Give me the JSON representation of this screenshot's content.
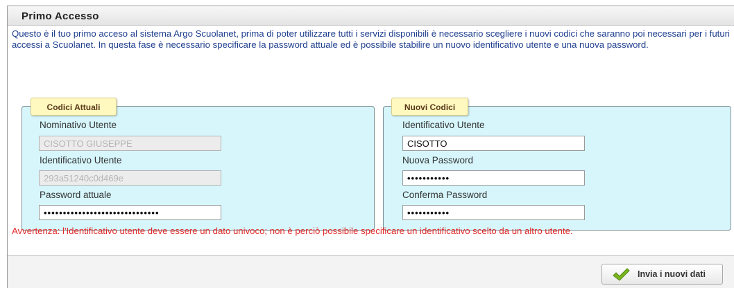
{
  "window": {
    "title": "Primo Accesso"
  },
  "intro_text": "Questo è il tuo primo acceso al sistema Argo Scuolanet, prima di poter utilizzare tutti i servizi disponibili è necessario scegliere i nuovi codici che saranno poi necessari per i futuri accessi a Scuolanet. In questa fase è necessario specificare la password attuale ed è possibile stabilire un nuovo identificativo utente e una nuova password.",
  "current_codes": {
    "legend": "Codici Attuali",
    "name_label": "Nominativo Utente",
    "name_value": "CISOTTO GIUSEPPE",
    "id_label": "Identificativo Utente",
    "id_value": "293a51240c0d469e",
    "password_label": "Password attuale",
    "password_value": "••••••••••••••••••••••••••••••"
  },
  "new_codes": {
    "legend": "Nuovi Codici",
    "id_label": "Identificativo Utente",
    "id_value": "CISOTTO",
    "new_password_label": "Nuova Password",
    "new_password_value": "•••••••••••",
    "confirm_password_label": "Conferma Password",
    "confirm_password_value": "•••••••••••"
  },
  "warning_text": "Avvertenza: l'Identificativo utente deve essere un dato univoco; non è perciò possibile specificare un identificativo scelto da un altro utente.",
  "submit": {
    "label": "Invia i nuovi dati",
    "icon": "check-icon"
  },
  "colors": {
    "intro": "#1f3f8e",
    "warning": "#e02a2a",
    "panel_bg": "#d6f6fb",
    "legend_bg": "#fff8bf",
    "check": "#7ab51d"
  }
}
